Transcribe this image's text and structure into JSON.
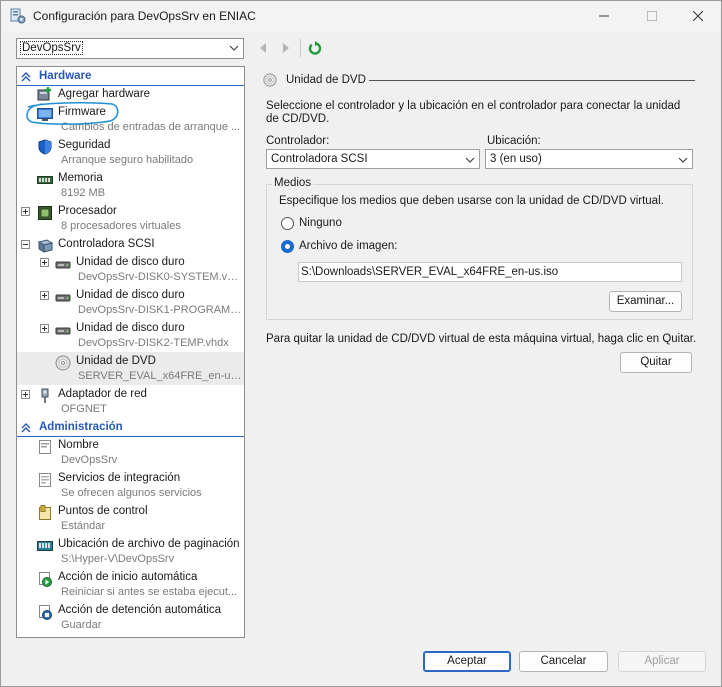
{
  "window": {
    "title": "Configuración para DevOpsSrv en ENIAC"
  },
  "toolbar": {
    "vm_name": "DevOpsSrv"
  },
  "tree": {
    "hardware_header": "Hardware",
    "admin_header": "Administración",
    "items": [
      {
        "name": "Agregar hardware",
        "sub": ""
      },
      {
        "name": "Firmware",
        "sub": "Cambios de entradas de arranque ..."
      },
      {
        "name": "Seguridad",
        "sub": "Arranque seguro habilitado"
      },
      {
        "name": "Memoria",
        "sub": "8192 MB"
      },
      {
        "name": "Procesador",
        "sub": "8 procesadores virtuales"
      },
      {
        "name": "Controladora SCSI",
        "sub": ""
      },
      {
        "name": "Unidad de disco duro",
        "sub": "DevOpsSrv-DISK0-SYSTEM.vhdx"
      },
      {
        "name": "Unidad de disco duro",
        "sub": "DevOpsSrv-DISK1-PROGRAMS...."
      },
      {
        "name": "Unidad de disco duro",
        "sub": "DevOpsSrv-DISK2-TEMP.vhdx"
      },
      {
        "name": "Unidad de DVD",
        "sub": "SERVER_EVAL_x64FRE_en-us...."
      },
      {
        "name": "Adaptador de red",
        "sub": "OFGNET"
      }
    ],
    "admin_items": [
      {
        "name": "Nombre",
        "sub": "DevOpsSrv"
      },
      {
        "name": "Servicios de integración",
        "sub": "Se ofrecen algunos servicios"
      },
      {
        "name": "Puntos de control",
        "sub": "Estándar"
      },
      {
        "name": "Ubicación de archivo de paginación ...",
        "sub": "S:\\Hyper-V\\DevOpsSrv"
      },
      {
        "name": "Acción de inicio automática",
        "sub": "Reiniciar si antes se estaba ejecut..."
      },
      {
        "name": "Acción de detención automática",
        "sub": "Guardar"
      }
    ]
  },
  "dvd": {
    "group_title": "Unidad de DVD",
    "description": "Seleccione el controlador y la ubicación en el controlador para conectar la unidad de CD/DVD.",
    "controller_label": "Controlador:",
    "controller_value": "Controladora SCSI",
    "location_label": "Ubicación:",
    "location_value": "3 (en uso)",
    "media_label": "Medios",
    "media_description": "Especifique los medios que deben usarse con la unidad de CD/DVD virtual.",
    "none_label": "Ninguno",
    "image_label": "Archivo de imagen:",
    "image_path": "S:\\Downloads\\SERVER_EVAL_x64FRE_en-us.iso",
    "browse_label": "Examinar...",
    "remove_text": "Para quitar la unidad de CD/DVD virtual de esta máquina virtual, haga clic en Quitar.",
    "remove_label": "Quitar"
  },
  "footer": {
    "ok_label": "Aceptar",
    "cancel_label": "Cancelar",
    "apply_label": "Aplicar"
  },
  "colors": {
    "accent": "#2c68c4",
    "annotation": "#1e8fd6"
  }
}
